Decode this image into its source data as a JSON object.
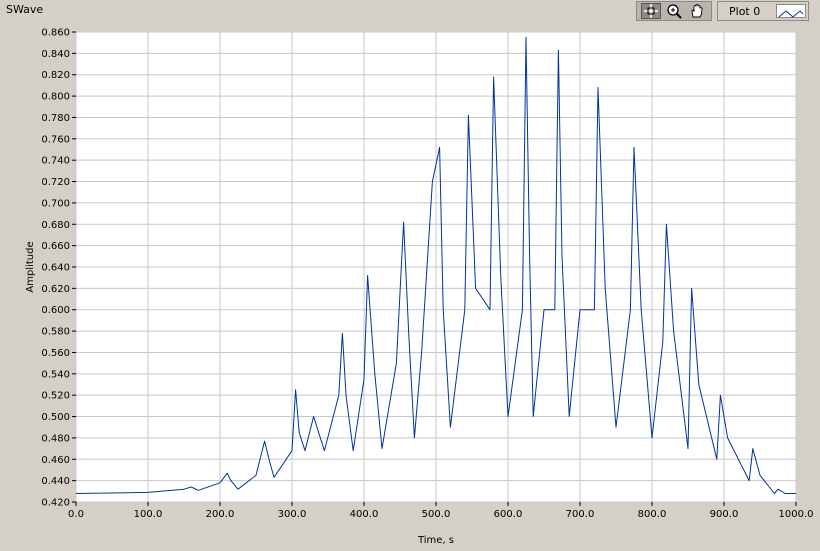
{
  "window": {
    "title": "SWave"
  },
  "toolbar": {
    "tools": [
      "crosshair-icon",
      "zoom-icon",
      "pan-hand-icon"
    ]
  },
  "legend": {
    "label": "Plot 0",
    "color": "#0033a0"
  },
  "chart_data": {
    "type": "line",
    "title": "",
    "xlabel": "Time, s",
    "ylabel": "Amplitude",
    "xlim": [
      0,
      1000
    ],
    "ylim": [
      0.42,
      0.86
    ],
    "x_ticks": [
      "0.0",
      "100.0",
      "200.0",
      "300.0",
      "400.0",
      "500.0",
      "600.0",
      "700.0",
      "800.0",
      "900.0",
      "1000.0"
    ],
    "y_ticks": [
      "0.420",
      "0.440",
      "0.460",
      "0.480",
      "0.500",
      "0.520",
      "0.540",
      "0.560",
      "0.580",
      "0.600",
      "0.620",
      "0.640",
      "0.660",
      "0.680",
      "0.700",
      "0.720",
      "0.740",
      "0.760",
      "0.780",
      "0.800",
      "0.820",
      "0.840",
      "0.860"
    ],
    "grid": true,
    "series": [
      {
        "name": "Plot 0",
        "color": "#0033a0",
        "x": [
          0,
          100,
          150,
          160,
          170,
          200,
          210,
          215,
          225,
          250,
          262,
          268,
          275,
          300,
          305,
          310,
          318,
          330,
          345,
          365,
          370,
          375,
          385,
          400,
          405,
          415,
          425,
          445,
          455,
          462,
          470,
          480,
          495,
          505,
          510,
          520,
          540,
          545,
          555,
          575,
          580,
          590,
          600,
          620,
          625,
          630,
          635,
          650,
          665,
          670,
          675,
          685,
          700,
          720,
          725,
          735,
          750,
          770,
          775,
          785,
          800,
          815,
          820,
          830,
          850,
          855,
          865,
          890,
          895,
          905,
          935,
          940,
          950,
          970,
          975,
          985,
          1000
        ],
        "y": [
          0.428,
          0.429,
          0.432,
          0.434,
          0.431,
          0.438,
          0.447,
          0.44,
          0.432,
          0.445,
          0.477,
          0.46,
          0.443,
          0.468,
          0.525,
          0.485,
          0.468,
          0.5,
          0.468,
          0.52,
          0.578,
          0.52,
          0.468,
          0.535,
          0.632,
          0.54,
          0.47,
          0.55,
          0.682,
          0.58,
          0.48,
          0.56,
          0.72,
          0.752,
          0.6,
          0.49,
          0.6,
          0.782,
          0.62,
          0.6,
          0.818,
          0.63,
          0.5,
          0.6,
          0.855,
          0.65,
          0.5,
          0.6,
          0.6,
          0.843,
          0.65,
          0.5,
          0.6,
          0.6,
          0.808,
          0.62,
          0.49,
          0.6,
          0.752,
          0.6,
          0.48,
          0.57,
          0.68,
          0.58,
          0.47,
          0.62,
          0.53,
          0.46,
          0.52,
          0.48,
          0.44,
          0.47,
          0.445,
          0.428,
          0.432,
          0.428,
          0.428
        ]
      }
    ]
  }
}
